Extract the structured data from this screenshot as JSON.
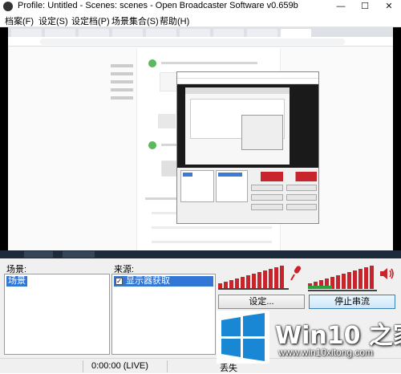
{
  "window": {
    "title": "Profile: Untitled - Scenes: scenes - Open Broadcaster Software v0.659b",
    "min_glyph": "—",
    "max_glyph": "☐",
    "close_glyph": "✕"
  },
  "menu": {
    "items": [
      {
        "label": "档案(F)"
      },
      {
        "label": "设定(S)"
      },
      {
        "label": "设定档(P)"
      },
      {
        "label": "场景集合(S)"
      },
      {
        "label": "帮助(H)"
      }
    ]
  },
  "panels": {
    "scenes_label": "场景:",
    "sources_label": "来源:",
    "scenes": [
      {
        "label": "场景",
        "selected": true
      }
    ],
    "sources": [
      {
        "label": "显示器获取",
        "checked": true,
        "selected": true
      }
    ]
  },
  "buttons": {
    "settings": "设定...",
    "stop_stream": "停止串流"
  },
  "status": {
    "time": "0:00:00 (LIVE)",
    "dropped": "丢失"
  },
  "audio": {
    "mic_level": 0.82,
    "desktop_level": 0.9
  },
  "colors": {
    "meter": "#c8242b",
    "selection": "#3377d6",
    "watermark_blue": "#1a87d4"
  },
  "watermark": {
    "title": "Win10 之家",
    "url": "www.win10xitong.com"
  }
}
